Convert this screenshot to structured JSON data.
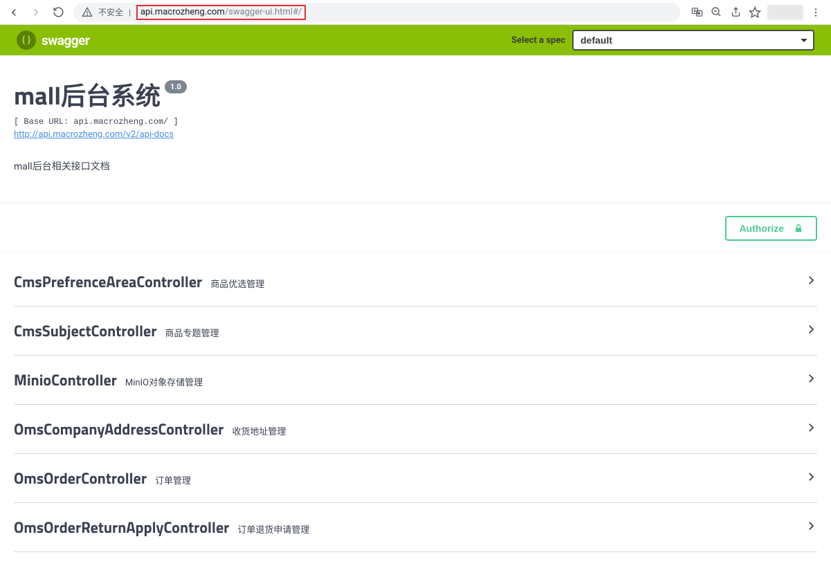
{
  "browser": {
    "insecure_label": "不安全",
    "url_host": "api.macrozheng.com",
    "url_path": "/swagger-ui.html#/"
  },
  "topbar": {
    "logo_text": "swagger",
    "spec_label": "Select a spec",
    "spec_value": "default"
  },
  "info": {
    "title": "mall后台系统",
    "version": "1.0",
    "base_url": "[ Base URL: api.macrozheng.com/ ]",
    "docs_link": "http://api.macrozheng.com/v2/api-docs",
    "description": "mall后台相关接口文档"
  },
  "auth": {
    "button_label": "Authorize"
  },
  "tags": [
    {
      "name": "CmsPrefrenceAreaController",
      "desc": "商品优选管理"
    },
    {
      "name": "CmsSubjectController",
      "desc": "商品专题管理"
    },
    {
      "name": "MinioController",
      "desc": "MinIO对象存储管理"
    },
    {
      "name": "OmsCompanyAddressController",
      "desc": "收货地址管理"
    },
    {
      "name": "OmsOrderController",
      "desc": "订单管理"
    },
    {
      "name": "OmsOrderReturnApplyController",
      "desc": "订单退货申请管理"
    }
  ]
}
